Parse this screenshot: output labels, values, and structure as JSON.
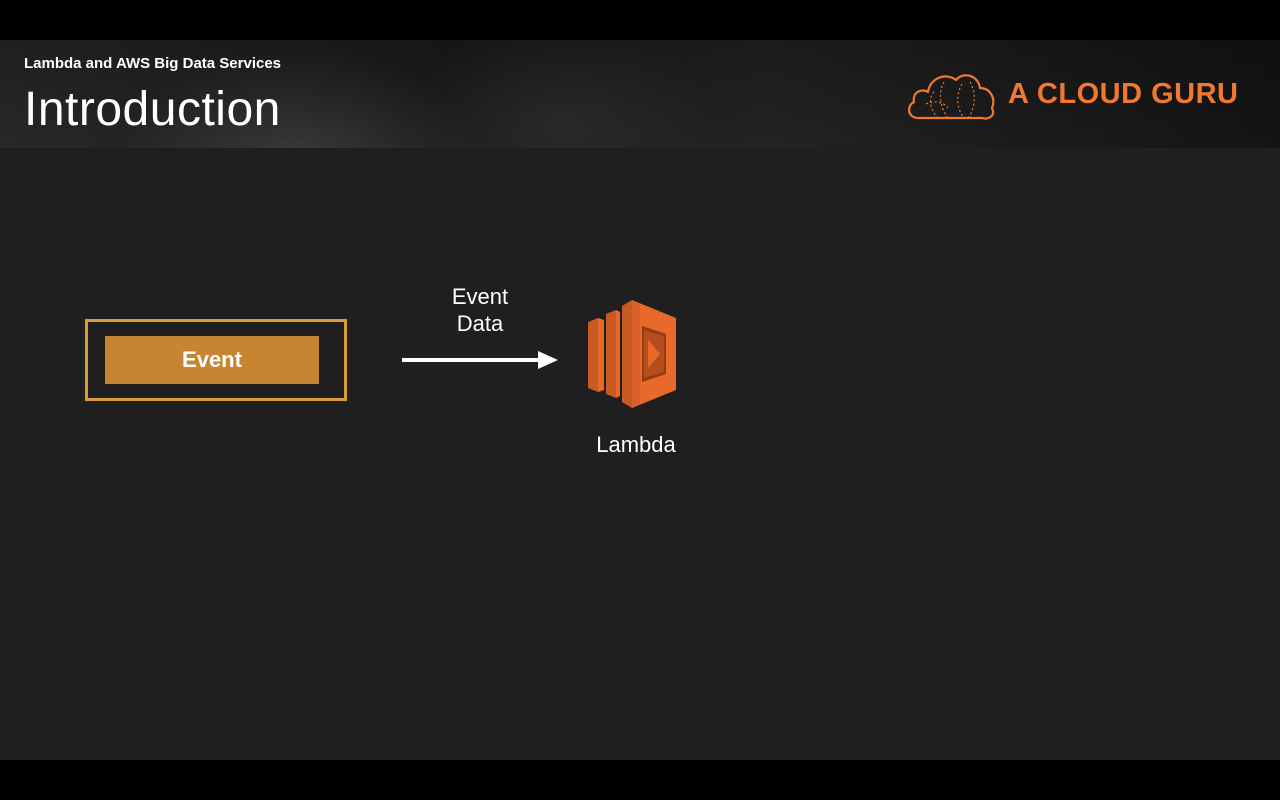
{
  "header": {
    "course_title": "Lambda and AWS Big Data Services",
    "slide_title": "Introduction",
    "logo_text": "A CLOUD GURU",
    "logo_icon": "cloud-icon",
    "logo_color": "#f0782f"
  },
  "diagram": {
    "event_label": "Event",
    "arrow_label_line1": "Event",
    "arrow_label_line2": "Data",
    "target_icon": "aws-lambda-icon",
    "target_label": "Lambda",
    "colors": {
      "event_frame": "#d99b3c",
      "event_fill": "#c78431",
      "lambda_orange": "#e8692a",
      "background": "#1f1f1f"
    }
  }
}
